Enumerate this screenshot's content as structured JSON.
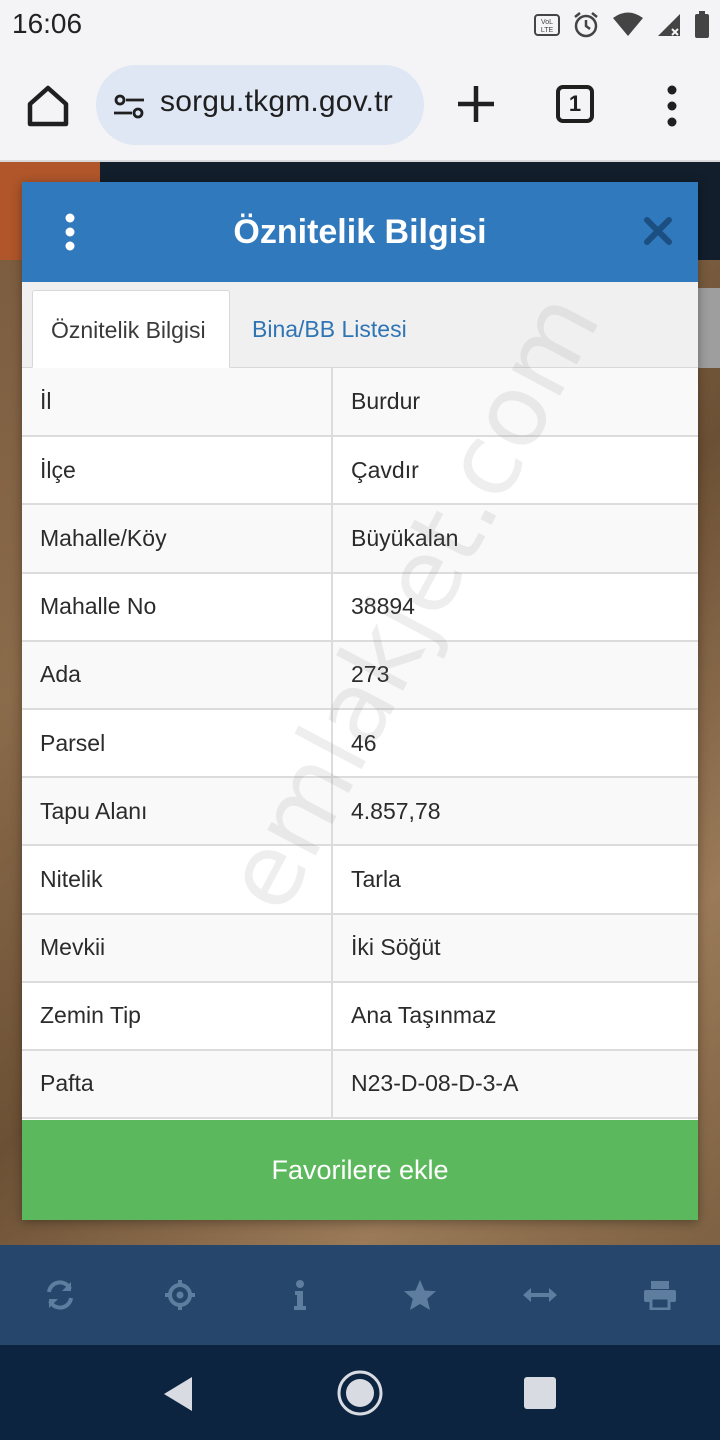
{
  "status_bar": {
    "time": "16:06",
    "icons": [
      "volte-icon",
      "alarm-icon",
      "wifi-icon",
      "signal-icon",
      "battery-icon"
    ]
  },
  "browser": {
    "url": "sorgu.tkgm.gov.tr",
    "tab_count": "1",
    "icons": [
      "home-icon",
      "site-settings-icon",
      "plus-icon",
      "more-vert-icon"
    ]
  },
  "modal": {
    "title": "Öznitelik Bilgisi",
    "tabs": [
      {
        "label": "Öznitelik Bilgisi",
        "active": true
      },
      {
        "label": "Bina/BB Listesi",
        "active": false
      }
    ],
    "rows": [
      {
        "key": "İl",
        "value": "Burdur"
      },
      {
        "key": "İlçe",
        "value": "Çavdır"
      },
      {
        "key": "Mahalle/Köy",
        "value": "Büyükalan"
      },
      {
        "key": "Mahalle No",
        "value": "38894"
      },
      {
        "key": "Ada",
        "value": "273"
      },
      {
        "key": "Parsel",
        "value": "46"
      },
      {
        "key": "Tapu Alanı",
        "value": "4.857,78"
      },
      {
        "key": "Nitelik",
        "value": "Tarla"
      },
      {
        "key": "Mevkii",
        "value": "İki Söğüt"
      },
      {
        "key": "Zemin Tip",
        "value": "Ana Taşınmaz"
      },
      {
        "key": "Pafta",
        "value": "N23-D-08-D-3-A"
      }
    ],
    "favorite_button": "Favorilere ekle"
  },
  "watermark": "emlakjet.com",
  "app_toolbar": {
    "icons": [
      "refresh-icon",
      "locate-icon",
      "info-icon",
      "star-icon",
      "measure-icon",
      "print-icon"
    ]
  },
  "colors": {
    "header_blue": "#3179bd",
    "button_green": "#5cb85c",
    "toolbar_navy": "#26476b",
    "tab_link_blue": "#2f74b5"
  }
}
